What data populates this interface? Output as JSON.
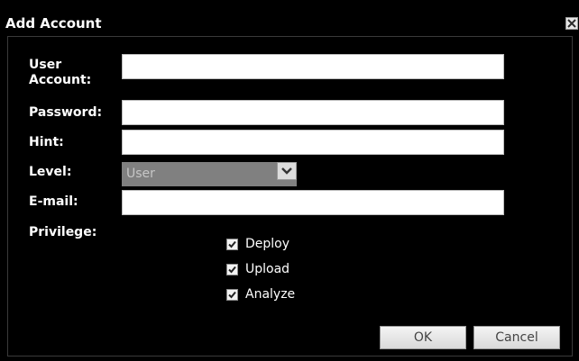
{
  "dialog": {
    "title": "Add Account",
    "close_icon": "close-icon"
  },
  "form": {
    "user_account": {
      "label": "User Account:",
      "value": ""
    },
    "password": {
      "label": "Password:",
      "value": ""
    },
    "hint": {
      "label": "Hint:",
      "value": ""
    },
    "level": {
      "label": "Level:",
      "selected": "User",
      "arrow_icon": "chevron-down-icon"
    },
    "email": {
      "label": "E-mail:",
      "value": ""
    },
    "privilege": {
      "label": "Privilege:",
      "options": [
        {
          "label": "Deploy",
          "checked": true
        },
        {
          "label": "Upload",
          "checked": true
        },
        {
          "label": "Analyze",
          "checked": true
        }
      ]
    }
  },
  "buttons": {
    "ok": "OK",
    "cancel": "Cancel"
  },
  "colors": {
    "background": "#000000",
    "text": "#ffffff",
    "input_bg": "#ffffff",
    "select_bg": "#808080"
  }
}
